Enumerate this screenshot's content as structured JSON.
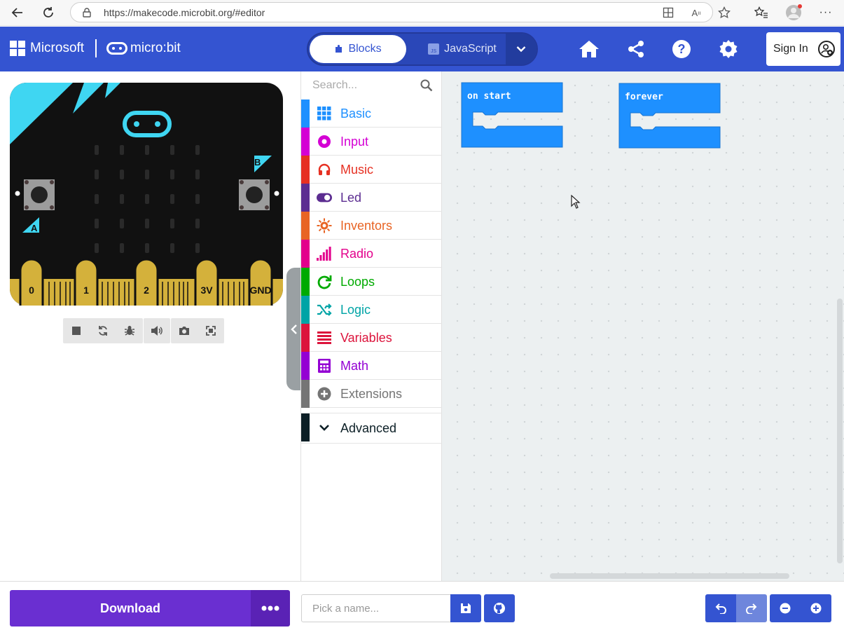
{
  "browser": {
    "url": "https://makecode.microbit.org/#editor"
  },
  "header": {
    "brand_microsoft": "Microsoft",
    "brand_microbit": "micro:bit",
    "tab_blocks": "Blocks",
    "tab_javascript": "JavaScript",
    "signin": "Sign In"
  },
  "simulator": {
    "pins": [
      "0",
      "1",
      "2",
      "3V",
      "GND"
    ],
    "button_a": "A",
    "button_b": "B"
  },
  "toolbox": {
    "search_placeholder": "Search...",
    "categories": [
      {
        "label": "Basic",
        "color": "#1E90FF",
        "icon": "grid-icon"
      },
      {
        "label": "Input",
        "color": "#D400D4",
        "icon": "target-icon"
      },
      {
        "label": "Music",
        "color": "#E63022",
        "icon": "headphones-icon"
      },
      {
        "label": "Led",
        "color": "#5C2D91",
        "icon": "toggle-icon"
      },
      {
        "label": "Inventors",
        "color": "#E86424",
        "icon": "sun-icon"
      },
      {
        "label": "Radio",
        "color": "#E3008C",
        "icon": "signal-icon"
      },
      {
        "label": "Loops",
        "color": "#00AA00",
        "icon": "refresh-icon"
      },
      {
        "label": "Logic",
        "color": "#00A4A6",
        "icon": "shuffle-icon"
      },
      {
        "label": "Variables",
        "color": "#DC143C",
        "icon": "list-icon"
      },
      {
        "label": "Math",
        "color": "#9400D3",
        "icon": "calculator-icon"
      },
      {
        "label": "Extensions",
        "color": "#757575",
        "icon": "plus-circle-icon"
      }
    ],
    "advanced": {
      "label": "Advanced",
      "color": "#0C1F26"
    }
  },
  "workspace": {
    "blocks": [
      {
        "label": "on start"
      },
      {
        "label": "forever"
      }
    ]
  },
  "footer": {
    "download": "Download",
    "name_placeholder": "Pick a name..."
  }
}
